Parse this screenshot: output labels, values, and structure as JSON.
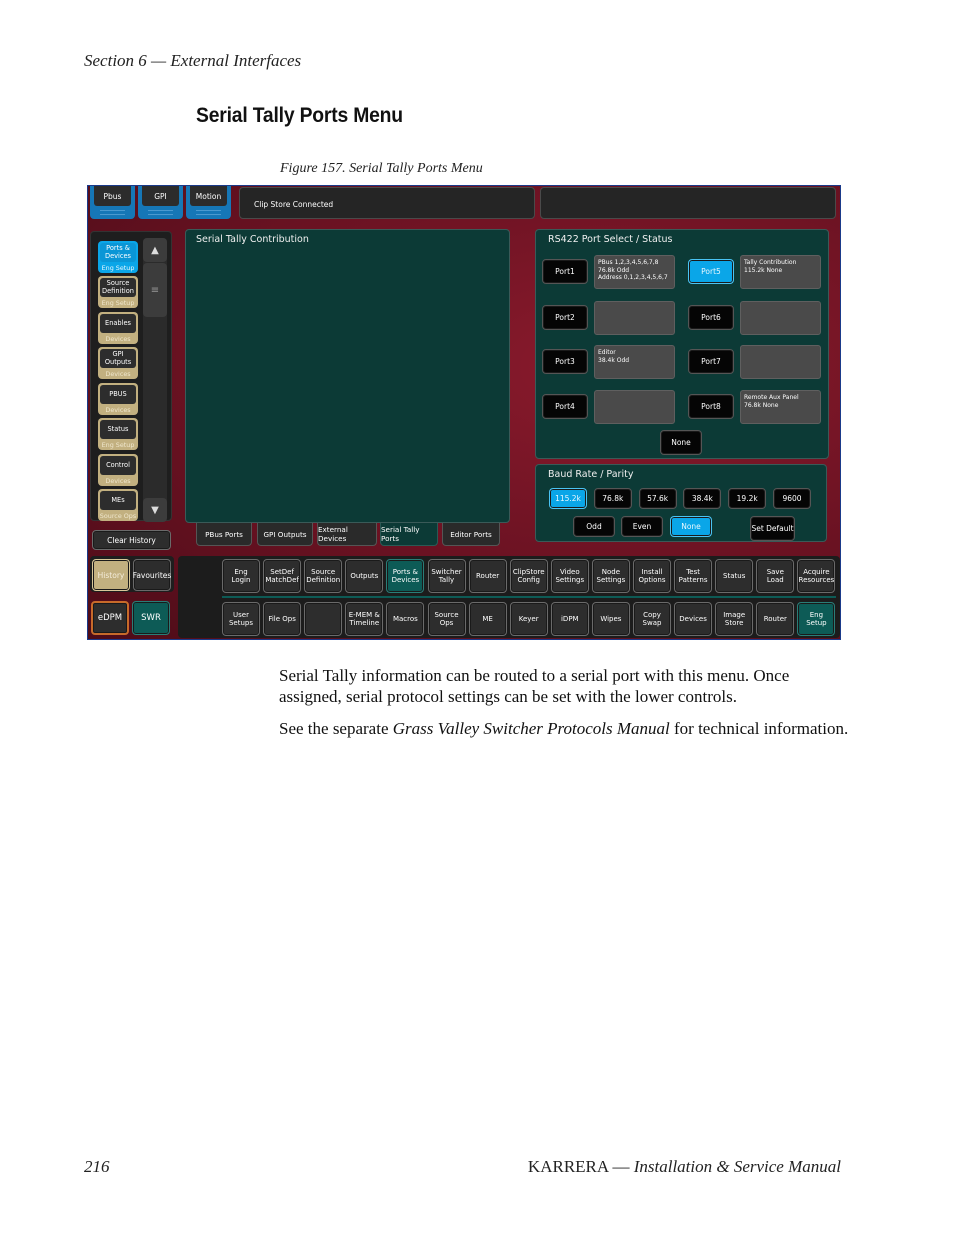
{
  "page": {
    "running_head": "Section 6 — External Interfaces",
    "section_title": "Serial Tally Ports Menu",
    "figure_caption": "Figure 157.  Serial Tally Ports Menu",
    "paragraphs": {
      "p1": "Serial Tally information can be routed to a serial port with this menu. Once assigned, serial protocol settings can be set with the lower controls.",
      "p2_prefix": "See the separate ",
      "p2_italic": "Grass Valley Switcher Protocols Manual",
      "p2_suffix": " for technical information."
    },
    "footer": {
      "page_number": "216",
      "product": "KARRERA",
      "dash": " — ",
      "manual_title": "Installation & Service Manual"
    }
  },
  "ui": {
    "colors": {
      "background_red": "#6a1220",
      "panel_teal": "#0c3a36",
      "selected_blue": "#0aa6e8",
      "category_tan": "#c2b080",
      "active_teal": "#0d5b56",
      "edpm_orange": "#c76a2a"
    },
    "top_buttons": [
      {
        "label": "Pbus"
      },
      {
        "label": "GPI"
      },
      {
        "label": "Motion"
      }
    ],
    "status_message": "Clip Store Connected",
    "sidebar": {
      "items": [
        {
          "label": "Ports & Devices",
          "category": "Eng  Setup",
          "active": true
        },
        {
          "label": "Source Definition",
          "category": "Eng  Setup",
          "active": false
        },
        {
          "label": "Enables",
          "category": "Devices",
          "active": false
        },
        {
          "label": "GPI Outputs",
          "category": "Devices",
          "active": false
        },
        {
          "label": "PBUS",
          "category": "Devices",
          "active": false
        },
        {
          "label": "Status",
          "category": "Eng  Setup",
          "active": false
        },
        {
          "label": "Control",
          "category": "Devices",
          "active": false
        },
        {
          "label": "MEs",
          "category": "Source Ops",
          "active": false
        }
      ],
      "scroll_up_icon": "▲",
      "scroll_down_icon": "▼",
      "scroll_thumb_icon": "≡",
      "clear_history": "Clear History",
      "history": "History",
      "favourites": "Favourites"
    },
    "contribution_panel": {
      "title": "Serial Tally Contribution"
    },
    "port_panel": {
      "title": "RS422 Port Select / Status",
      "ports": [
        {
          "label": "Port1",
          "status": [
            "PBus 1,2,3,4,5,6,7,8",
            "76.8k Odd",
            "Address 0,1,2,3,4,5,6,7"
          ],
          "selected": false
        },
        {
          "label": "Port2",
          "status": [],
          "selected": false
        },
        {
          "label": "Port3",
          "status": [
            "Editor",
            "38.4k Odd"
          ],
          "selected": false
        },
        {
          "label": "Port4",
          "status": [],
          "selected": false
        },
        {
          "label": "Port5",
          "status": [
            "Tally Contribution",
            "115.2k None"
          ],
          "selected": true
        },
        {
          "label": "Port6",
          "status": [],
          "selected": false
        },
        {
          "label": "Port7",
          "status": [],
          "selected": false
        },
        {
          "label": "Port8",
          "status": [
            "Remote Aux Panel",
            "76.8k None"
          ],
          "selected": false
        }
      ],
      "none_button": "None"
    },
    "baud_panel": {
      "title": "Baud Rate / Parity",
      "baud_rates": [
        "115.2k",
        "76.8k",
        "57.6k",
        "38.4k",
        "19.2k",
        "9600"
      ],
      "selected_baud": "115.2k",
      "parities": [
        "Odd",
        "Even",
        "None"
      ],
      "selected_parity": "None",
      "set_default": "Set Default"
    },
    "tabs": [
      {
        "label": "PBus Ports",
        "active": false
      },
      {
        "label": "GPI Outputs",
        "active": false
      },
      {
        "label": "External Devices",
        "active": false
      },
      {
        "label": "Serial Tally Ports",
        "active": true
      },
      {
        "label": "Editor Ports",
        "active": false
      }
    ],
    "menu_row1": [
      {
        "label": "Eng Login",
        "active": false
      },
      {
        "label": "SetDef MatchDef",
        "active": false
      },
      {
        "label": "Source Definition",
        "active": false
      },
      {
        "label": "Outputs",
        "active": false
      },
      {
        "label": "Ports & Devices",
        "active": true
      },
      {
        "label": "Switcher Tally",
        "active": false
      },
      {
        "label": "Router",
        "active": false
      },
      {
        "label": "ClipStore Config",
        "active": false
      },
      {
        "label": "Video Settings",
        "active": false
      },
      {
        "label": "Node Settings",
        "active": false
      },
      {
        "label": "Install Options",
        "active": false
      },
      {
        "label": "Test Patterns",
        "active": false
      },
      {
        "label": "Status",
        "active": false
      },
      {
        "label": "Save Load",
        "active": false
      },
      {
        "label": "Acquire Resources",
        "active": false
      }
    ],
    "menu_row2": [
      {
        "label": "User Setups",
        "active": false
      },
      {
        "label": "File Ops",
        "active": false
      },
      {
        "label": "",
        "active": false
      },
      {
        "label": "E-MEM & Timeline",
        "active": false
      },
      {
        "label": "Macros",
        "active": false
      },
      {
        "label": "Source Ops",
        "active": false
      },
      {
        "label": "ME",
        "active": false
      },
      {
        "label": "Keyer",
        "active": false
      },
      {
        "label": "iDPM",
        "active": false
      },
      {
        "label": "Wipes",
        "active": false
      },
      {
        "label": "Copy Swap",
        "active": false
      },
      {
        "label": "Devices",
        "active": false
      },
      {
        "label": "Image Store",
        "active": false
      },
      {
        "label": "Router",
        "active": false
      },
      {
        "label": "Eng Setup",
        "active": true
      }
    ],
    "edpm": "eDPM",
    "swr": "SWR"
  }
}
